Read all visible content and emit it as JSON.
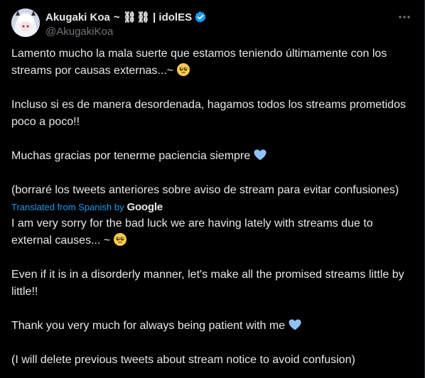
{
  "tweet": {
    "author": {
      "display_name": "Akugaki Koa",
      "name_suffix": "~ ⛓⛓ | idolES",
      "handle": "@AkugakiKoa",
      "verified_color": "#1d9bf0"
    },
    "more_icon": "more-horizontal-icon",
    "original": {
      "p1": "Lamento mucho la mala suerte que estamos teniendo últimamente con los streams por causas externas...~",
      "p2": "Incluso si es de manera desordenada, hagamos todos los streams prometidos poco a poco!!",
      "p3": "Muchas gracias por tenerme paciencia siempre",
      "p4": "(borraré los tweets anteriores sobre aviso de stream para evitar confusiones)"
    },
    "translation": {
      "label": "Translated from Spanish by",
      "provider": "Google",
      "p1": "I am very sorry for the bad luck we are having lately with streams due to external causes... ~",
      "p2": "Even if it is in a disorderly manner, let's make all the promised streams little by little!!",
      "p3": "Thank you very much for always being patient with me",
      "p4": "(I will delete previous tweets about stream notice to avoid confusion)"
    }
  },
  "colors": {
    "background": "#000000",
    "text": "#e7e9ea",
    "secondary": "#71767b",
    "accent": "#1d9bf0",
    "heart": "#8ec3f5"
  }
}
